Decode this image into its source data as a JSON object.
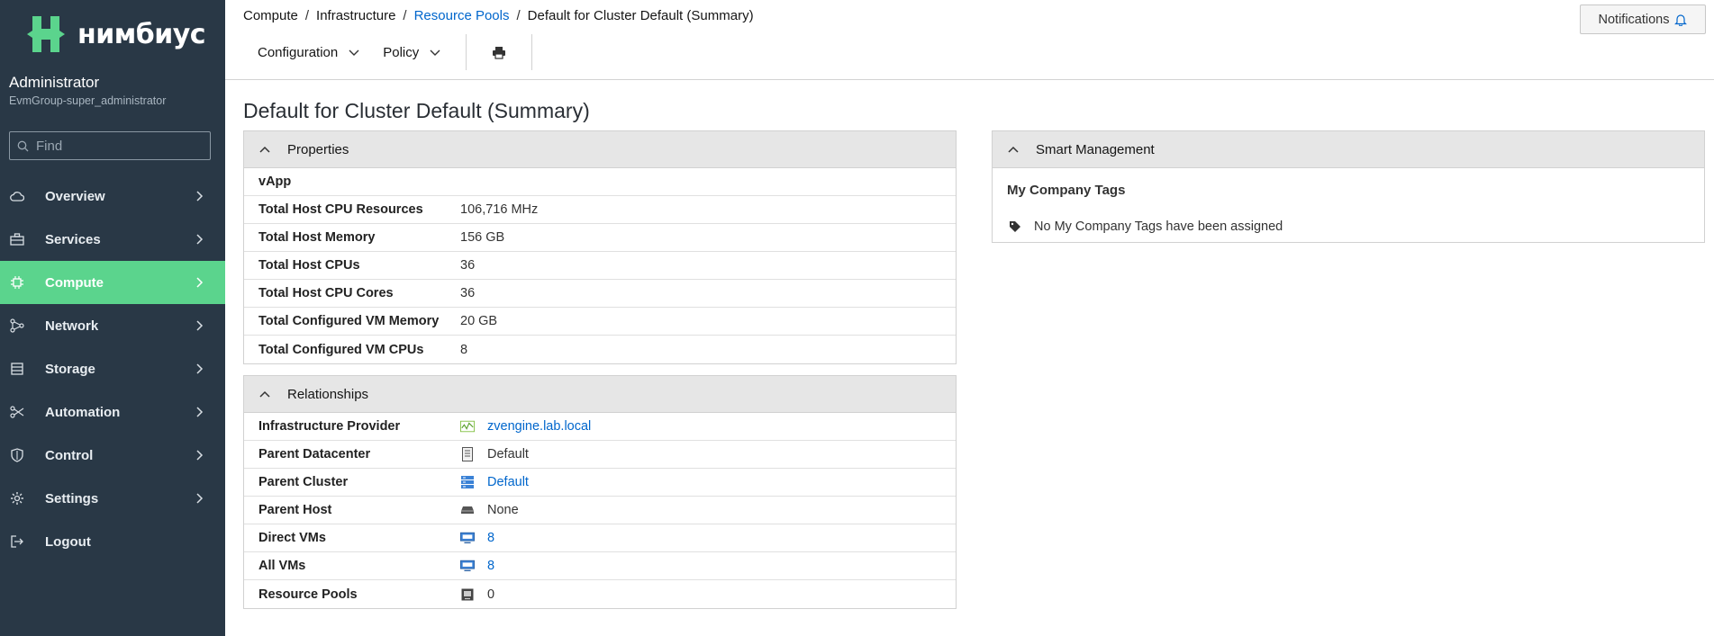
{
  "brand": {
    "name": "нимбиус",
    "accent": "#5bd48d",
    "sidebar_bg": "#293846"
  },
  "user": {
    "name": "Administrator",
    "group": "EvmGroup-super_administrator"
  },
  "search": {
    "placeholder": "Find"
  },
  "nav": [
    {
      "label": "Overview",
      "icon": "cloud-icon",
      "active": false
    },
    {
      "label": "Services",
      "icon": "briefcase-icon",
      "active": false
    },
    {
      "label": "Compute",
      "icon": "cpu-icon",
      "active": true
    },
    {
      "label": "Network",
      "icon": "network-icon",
      "active": false
    },
    {
      "label": "Storage",
      "icon": "database-icon",
      "active": false
    },
    {
      "label": "Automation",
      "icon": "automation-icon",
      "active": false
    },
    {
      "label": "Control",
      "icon": "shield-icon",
      "active": false
    },
    {
      "label": "Settings",
      "icon": "gear-icon",
      "active": false
    },
    {
      "label": "Logout",
      "icon": "logout-icon",
      "active": false
    }
  ],
  "breadcrumb": {
    "items": [
      "Compute",
      "Infrastructure",
      "Resource Pools",
      "Default for Cluster Default (Summary)"
    ],
    "sep": "/"
  },
  "notifications": {
    "label": "Notifications"
  },
  "toolbar": {
    "configuration": "Configuration",
    "policy": "Policy"
  },
  "page_title": "Default for Cluster Default (Summary)",
  "properties": {
    "title": "Properties",
    "rows": [
      {
        "key": "vApp",
        "value": ""
      },
      {
        "key": "Total Host CPU Resources",
        "value": "106,716 MHz"
      },
      {
        "key": "Total Host Memory",
        "value": "156 GB"
      },
      {
        "key": "Total Host CPUs",
        "value": "36"
      },
      {
        "key": "Total Host CPU Cores",
        "value": "36"
      },
      {
        "key": "Total Configured VM Memory",
        "value": "20 GB"
      },
      {
        "key": "Total Configured VM CPUs",
        "value": "8"
      }
    ]
  },
  "relationships": {
    "title": "Relationships",
    "rows": [
      {
        "key": "Infrastructure Provider",
        "value": "zvengine.lab.local",
        "icon": "provider-icon",
        "link": true
      },
      {
        "key": "Parent Datacenter",
        "value": "Default",
        "icon": "datacenter-icon",
        "link": false
      },
      {
        "key": "Parent Cluster",
        "value": "Default",
        "icon": "cluster-icon",
        "link": true
      },
      {
        "key": "Parent Host",
        "value": "None",
        "icon": "host-icon",
        "link": false
      },
      {
        "key": "Direct VMs",
        "value": "8",
        "icon": "vm-icon",
        "link": true
      },
      {
        "key": "All VMs",
        "value": "8",
        "icon": "vm-icon",
        "link": true
      },
      {
        "key": "Resource Pools",
        "value": "0",
        "icon": "resource-pool-icon",
        "link": false
      }
    ]
  },
  "smart_management": {
    "title": "Smart Management",
    "tags_heading": "My Company Tags",
    "no_tags": "No My Company Tags have been assigned"
  }
}
